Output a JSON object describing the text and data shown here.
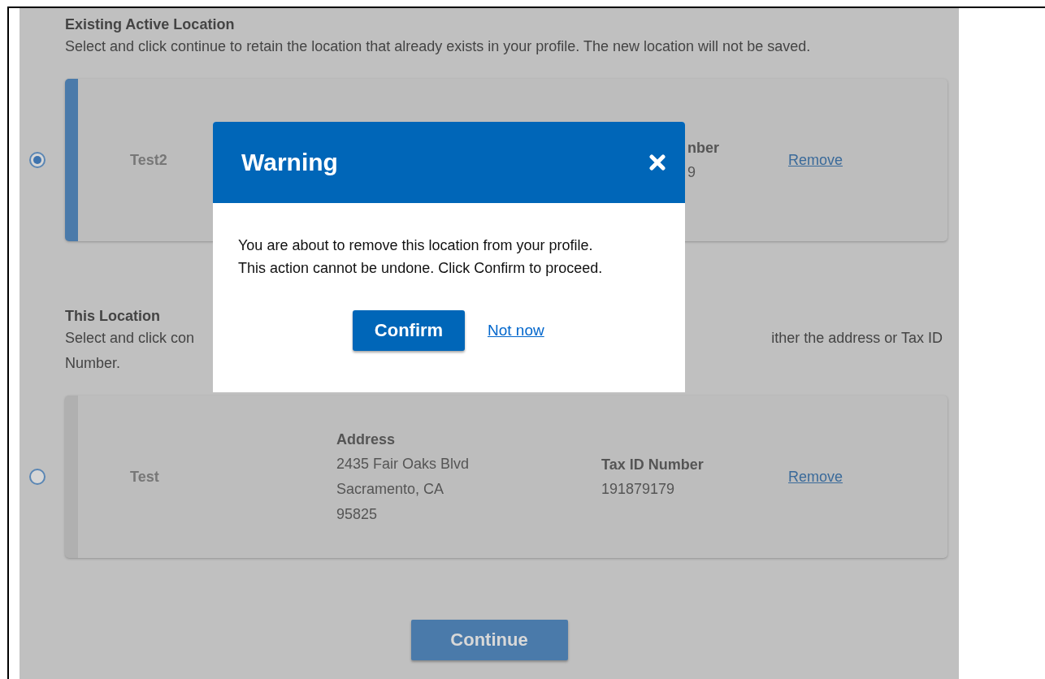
{
  "sections": [
    {
      "heading": "Existing Active Location",
      "description": [
        [
          "Select and click continue to retain the location that already exists in your profile. The new location will not be saved."
        ]
      ],
      "location": {
        "kind": "covered",
        "selected": true,
        "name": "Test2",
        "tax_label": "nber",
        "tax_value": "9",
        "remove": "Remove"
      }
    },
    {
      "heading": "This Location",
      "description": [
        [
          "Select and click con",
          "ither the address or Tax ID"
        ],
        [
          "Number."
        ]
      ],
      "location": {
        "kind": "full",
        "selected": false,
        "name": "Test",
        "address_label": "Address",
        "address_lines": [
          "2435 Fair Oaks Blvd",
          "Sacramento, CA",
          "95825"
        ],
        "tax_label": "Tax ID Number",
        "tax_value": "191879179",
        "remove": "Remove"
      }
    }
  ],
  "continue_button": "Continue",
  "modal": {
    "title": "Warning",
    "message_lines": [
      "You are about to remove this location from your profile.",
      "This action cannot be undone. Click Confirm to proceed."
    ],
    "confirm_button": "Confirm",
    "cancel_link": "Not now"
  }
}
